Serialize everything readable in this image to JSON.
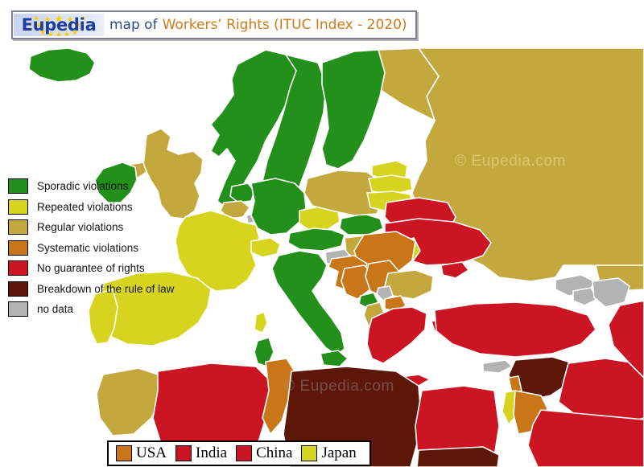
{
  "title": {
    "brand": "Eupedia",
    "connector": "map of",
    "subject": "Workers’ Rights (ITUC Index - 2020)"
  },
  "legend": {
    "items": [
      {
        "label": "Sporadic violations",
        "color": "#22901a"
      },
      {
        "label": "Repeated violations",
        "color": "#d7d41f"
      },
      {
        "label": "Regular violations",
        "color": "#c3a83d"
      },
      {
        "label": "Systematic violations",
        "color": "#c87617"
      },
      {
        "label": "No guarantee of rights",
        "color": "#cc1522"
      },
      {
        "label": "Breakdown of the rule of law",
        "color": "#5c1709"
      },
      {
        "label": "no data",
        "color": "#b3b3b3"
      }
    ]
  },
  "country_bar": {
    "items": [
      {
        "label": "USA",
        "color": "#c87617"
      },
      {
        "label": "India",
        "color": "#cc1522"
      },
      {
        "label": "China",
        "color": "#cc1522"
      },
      {
        "label": "Japan",
        "color": "#d7d41f"
      }
    ]
  },
  "watermarks": {
    "center": "© Eupedia.com",
    "russia": "© Eupedia.com"
  },
  "map_data": {
    "type": "choropleth",
    "projection": "europe-mediterranean",
    "background_sea": "#ffffff",
    "border_color": "#ffffff",
    "categories": [
      "Sporadic violations",
      "Repeated violations",
      "Regular violations",
      "Systematic violations",
      "No guarantee of rights",
      "Breakdown of the rule of law",
      "no data"
    ],
    "countries": [
      {
        "name": "Iceland",
        "category": "Sporadic violations"
      },
      {
        "name": "Norway",
        "category": "Sporadic violations"
      },
      {
        "name": "Sweden",
        "category": "Sporadic violations"
      },
      {
        "name": "Finland",
        "category": "Sporadic violations"
      },
      {
        "name": "Denmark",
        "category": "Sporadic violations"
      },
      {
        "name": "Ireland",
        "category": "Sporadic violations"
      },
      {
        "name": "Netherlands",
        "category": "Sporadic violations"
      },
      {
        "name": "Germany",
        "category": "Sporadic violations"
      },
      {
        "name": "Austria",
        "category": "Sporadic violations"
      },
      {
        "name": "Italy",
        "category": "Sporadic violations"
      },
      {
        "name": "Slovakia",
        "category": "Sporadic violations"
      },
      {
        "name": "Montenegro",
        "category": "Sporadic violations"
      },
      {
        "name": "United Kingdom",
        "category": "Regular violations"
      },
      {
        "name": "France",
        "category": "Repeated violations"
      },
      {
        "name": "Spain",
        "category": "Repeated violations"
      },
      {
        "name": "Portugal",
        "category": "Repeated violations"
      },
      {
        "name": "Switzerland",
        "category": "Repeated violations"
      },
      {
        "name": "Czechia",
        "category": "Repeated violations"
      },
      {
        "name": "Belgium",
        "category": "Regular violations"
      },
      {
        "name": "Poland",
        "category": "Regular violations"
      },
      {
        "name": "Estonia",
        "category": "Repeated violations"
      },
      {
        "name": "Latvia",
        "category": "Repeated violations"
      },
      {
        "name": "Lithuania",
        "category": "Repeated violations"
      },
      {
        "name": "Moldova",
        "category": "Repeated violations"
      },
      {
        "name": "Hungary",
        "category": "Regular violations"
      },
      {
        "name": "Bulgaria",
        "category": "Regular violations"
      },
      {
        "name": "Albania",
        "category": "Regular violations"
      },
      {
        "name": "Morocco",
        "category": "Regular violations"
      },
      {
        "name": "Russia",
        "category": "Regular violations"
      },
      {
        "name": "Kazakhstan",
        "category": "Regular violations"
      },
      {
        "name": "Romania",
        "category": "Systematic violations"
      },
      {
        "name": "Serbia",
        "category": "Systematic violations"
      },
      {
        "name": "Bosnia and Herzegovina",
        "category": "Systematic violations"
      },
      {
        "name": "Croatia",
        "category": "Systematic violations"
      },
      {
        "name": "North Macedonia",
        "category": "Systematic violations"
      },
      {
        "name": "Tunisia",
        "category": "Systematic violations"
      },
      {
        "name": "Jordan",
        "category": "Systematic violations"
      },
      {
        "name": "Lebanon",
        "category": "Systematic violations"
      },
      {
        "name": "Israel",
        "category": "Repeated violations"
      },
      {
        "name": "Belarus",
        "category": "No guarantee of rights"
      },
      {
        "name": "Ukraine",
        "category": "No guarantee of rights"
      },
      {
        "name": "Greece",
        "category": "No guarantee of rights"
      },
      {
        "name": "Turkey",
        "category": "No guarantee of rights"
      },
      {
        "name": "Iraq",
        "category": "No guarantee of rights"
      },
      {
        "name": "Saudi Arabia",
        "category": "No guarantee of rights"
      },
      {
        "name": "Iran",
        "category": "No guarantee of rights"
      },
      {
        "name": "Egypt",
        "category": "No guarantee of rights"
      },
      {
        "name": "Algeria",
        "category": "No guarantee of rights"
      },
      {
        "name": "Syria",
        "category": "Breakdown of the rule of law"
      },
      {
        "name": "Libya",
        "category": "Breakdown of the rule of law"
      },
      {
        "name": "Sudan",
        "category": "Breakdown of the rule of law"
      },
      {
        "name": "Slovenia",
        "category": "no data"
      },
      {
        "name": "Kosovo",
        "category": "no data"
      },
      {
        "name": "Cyprus",
        "category": "no data"
      },
      {
        "name": "Georgia",
        "category": "no data"
      },
      {
        "name": "Armenia",
        "category": "no data"
      },
      {
        "name": "Azerbaijan",
        "category": "no data"
      },
      {
        "name": "Luxembourg",
        "category": "no data"
      }
    ]
  }
}
